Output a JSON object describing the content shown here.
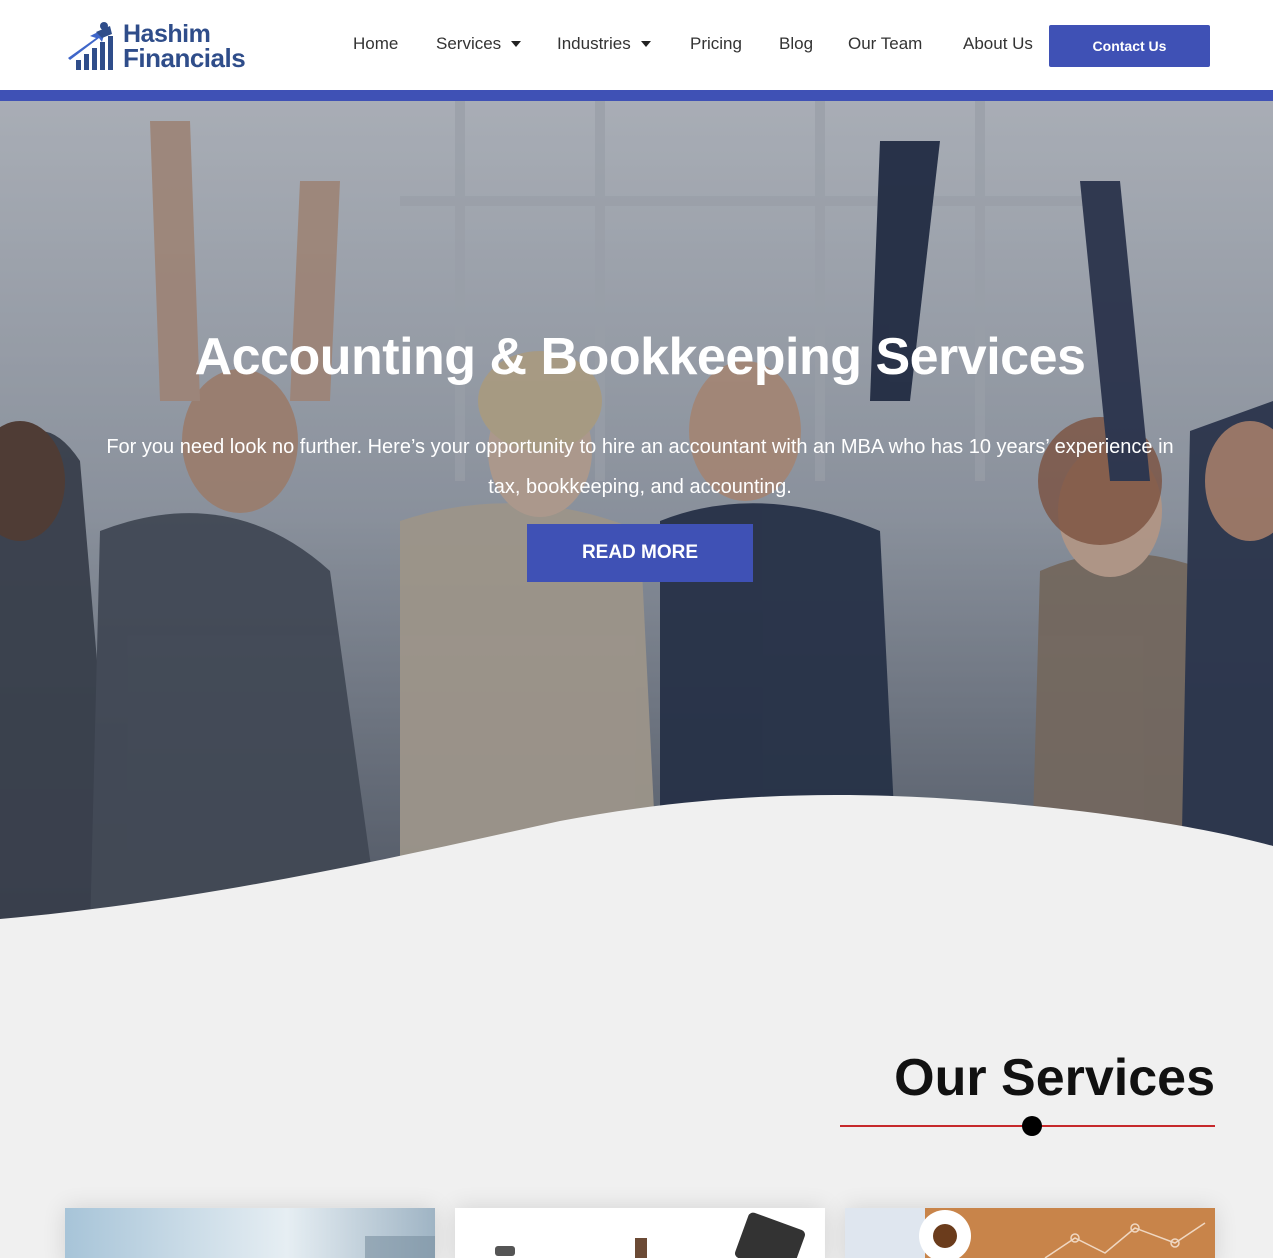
{
  "brand": {
    "line1": "Hashim",
    "line2": "Financials"
  },
  "nav": {
    "items": [
      {
        "label": "Home"
      },
      {
        "label": "Services"
      },
      {
        "label": "Industries"
      },
      {
        "label": "Pricing"
      },
      {
        "label": "Blog"
      },
      {
        "label": "Our Team"
      },
      {
        "label": "About Us"
      }
    ],
    "contact_label": "Contact Us"
  },
  "hero": {
    "title": "Accounting & Bookkeeping Services",
    "subtitle": "For you need look no further. Here’s your opportunity to hire an accountant with an MBA who has 10 years’ experience in tax, bookkeeping, and accounting.",
    "button_label": "READ MORE"
  },
  "services": {
    "title": "Our Services"
  },
  "colors": {
    "accent": "#3f51b5",
    "divider": "#c6282b",
    "brand_text": "#2f4d8a",
    "page_bg": "#f0f0f0"
  }
}
